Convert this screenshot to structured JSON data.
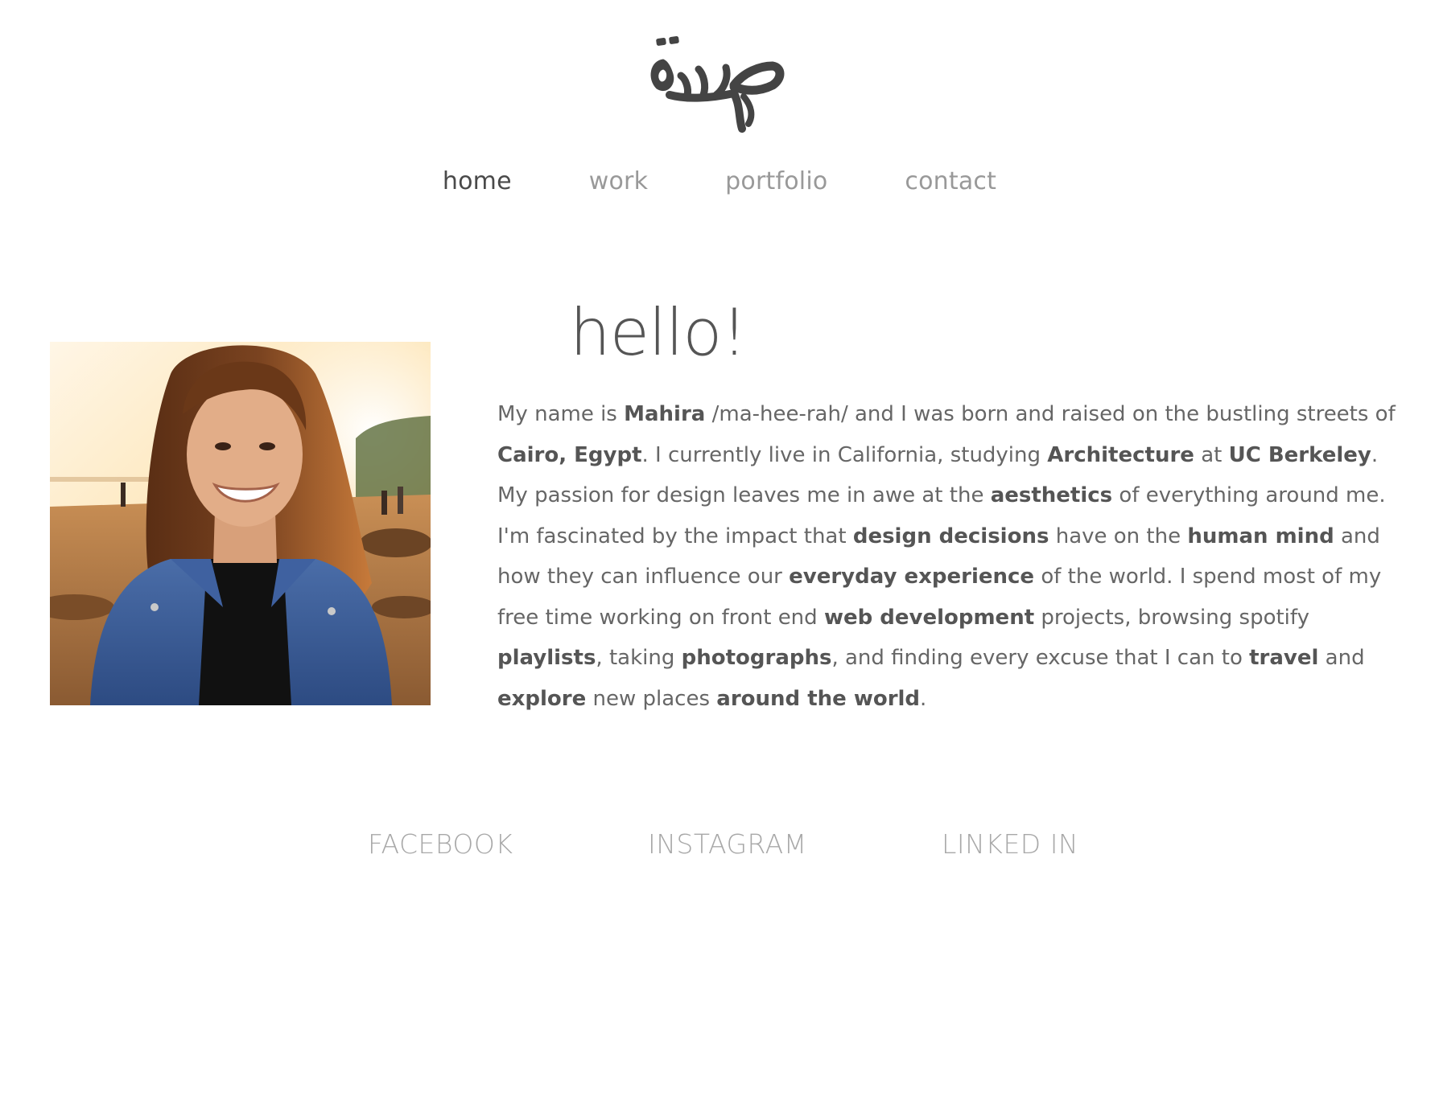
{
  "logo": {
    "icon": "arabic-calligraphy-logo"
  },
  "nav": {
    "items": [
      {
        "label": "home",
        "active": true
      },
      {
        "label": "work",
        "active": false
      },
      {
        "label": "portfolio",
        "active": false
      },
      {
        "label": "contact",
        "active": false
      }
    ]
  },
  "about": {
    "heading": "hello!",
    "photo": "portrait-photo",
    "bio": [
      {
        "t": "My name is ",
        "b": false
      },
      {
        "t": "Mahira",
        "b": true
      },
      {
        "t": " /ma-hee-rah/ and I was born and raised on the bustling streets of ",
        "b": false
      },
      {
        "t": "Cairo, Egypt",
        "b": true
      },
      {
        "t": ". I currently live in California, studying ",
        "b": false
      },
      {
        "t": "Architecture",
        "b": true
      },
      {
        "t": " at ",
        "b": false
      },
      {
        "t": "UC Berkeley",
        "b": true
      },
      {
        "t": ". My passion for design leaves me in awe at the ",
        "b": false
      },
      {
        "t": "aesthetics",
        "b": true
      },
      {
        "t": " of everything around me. I'm fascinated by the impact that ",
        "b": false
      },
      {
        "t": "design decisions",
        "b": true
      },
      {
        "t": " have on the ",
        "b": false
      },
      {
        "t": "human mind",
        "b": true
      },
      {
        "t": " and how they can influence our ",
        "b": false
      },
      {
        "t": "everyday experience",
        "b": true
      },
      {
        "t": " of the world. I spend most of my free time working on front end ",
        "b": false
      },
      {
        "t": "web development",
        "b": true
      },
      {
        "t": " projects, browsing spotify ",
        "b": false
      },
      {
        "t": "playlists",
        "b": true
      },
      {
        "t": ", taking ",
        "b": false
      },
      {
        "t": "photographs",
        "b": true
      },
      {
        "t": ", and finding every excuse that I can to ",
        "b": false
      },
      {
        "t": "travel",
        "b": true
      },
      {
        "t": " and ",
        "b": false
      },
      {
        "t": "explore",
        "b": true
      },
      {
        "t": " new places ",
        "b": false
      },
      {
        "t": "around the world",
        "b": true
      },
      {
        "t": ".",
        "b": false
      }
    ]
  },
  "social": {
    "facebook": "FACEBOOK",
    "instagram": "INSTAGRAM",
    "linkedin": "LINKED IN"
  },
  "colors": {
    "text": "#555555",
    "nav_inactive": "#999999",
    "social": "#a8a8a8",
    "background": "#ffffff"
  }
}
